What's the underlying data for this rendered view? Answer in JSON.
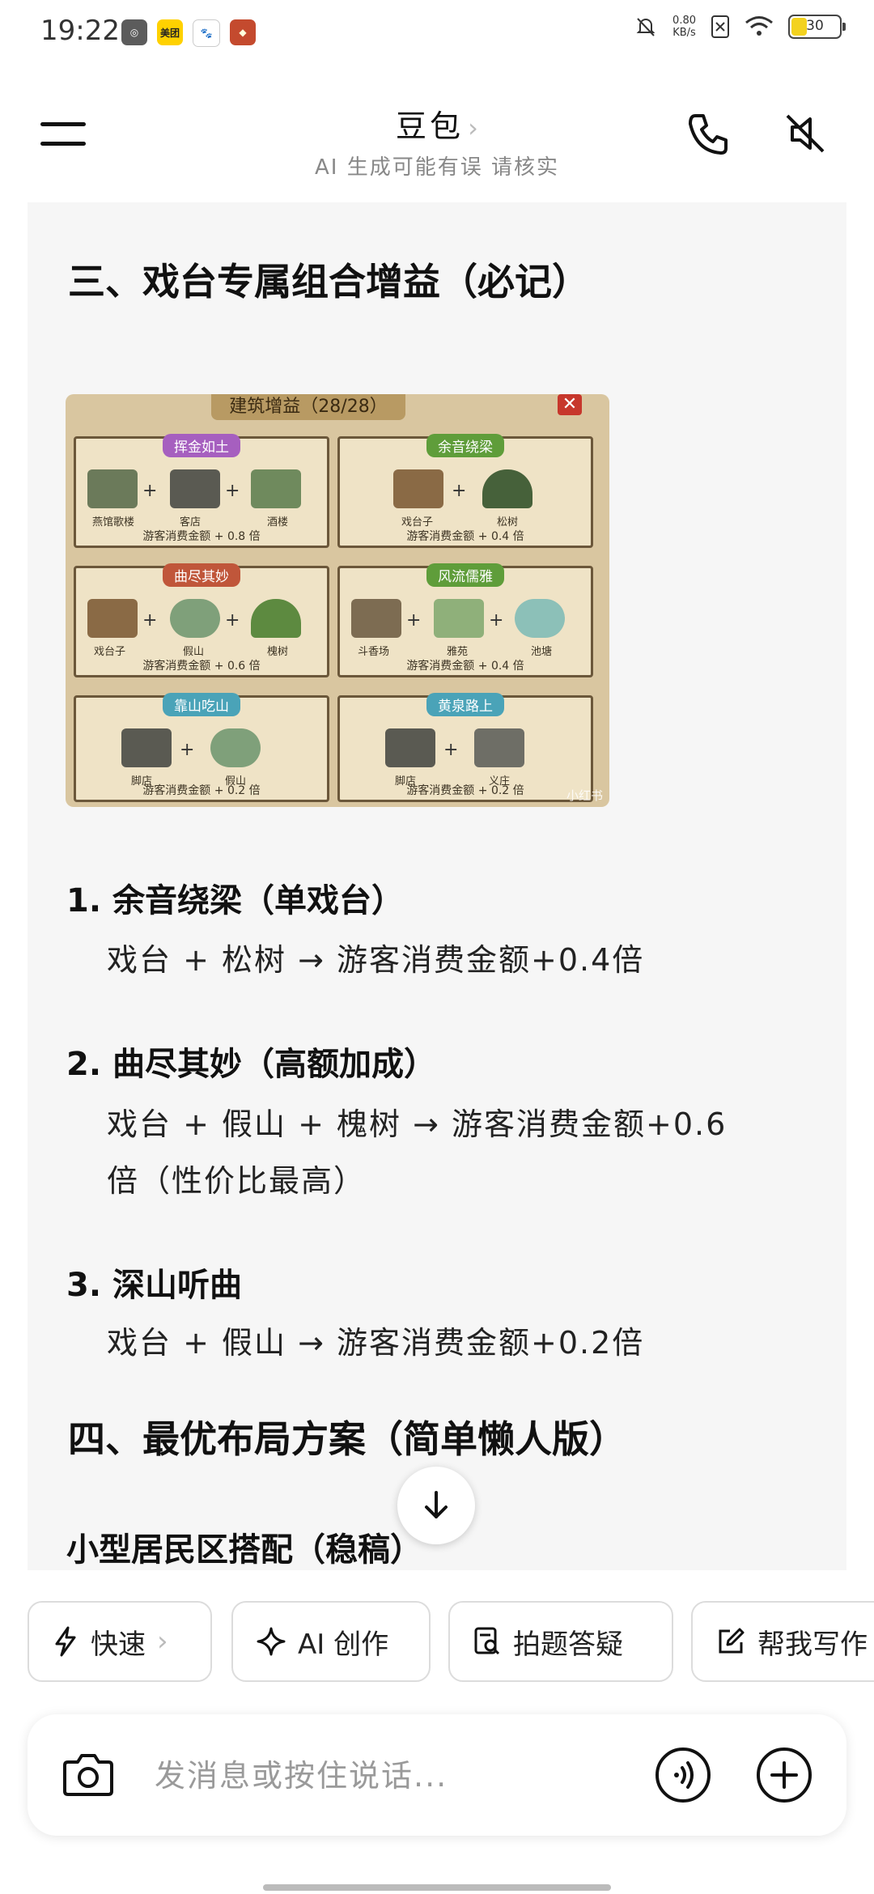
{
  "status_bar": {
    "time": "19:22",
    "app_icons": [
      "weixin-icon",
      "meituan-icon",
      "baidu-icon",
      "game-icon"
    ],
    "meituan_label": "美团",
    "net_speed_value": "0.80",
    "net_speed_unit": "KB/s",
    "battery": "30",
    "battery_level": 0.3
  },
  "header": {
    "title": "豆包",
    "chevron": "›",
    "subtitle": "AI 生成可能有误 请核实"
  },
  "content": {
    "section3_heading": "三、戏台专属组合增益（必记）",
    "image": {
      "header": "建筑增益（28/28）",
      "close": "✕",
      "watermark": "小红书",
      "panels": [
        {
          "tag": "挥金如土",
          "tag_color": "#a65fbf",
          "buildings": [
            "燕馆歌楼",
            "客店",
            "酒楼"
          ],
          "footer": "游客消费金额 + 0.8 倍"
        },
        {
          "tag": "余音绕梁",
          "tag_color": "#5f9d3a",
          "buildings": [
            "戏台子",
            "松树"
          ],
          "footer": "游客消费金额 + 0.4 倍"
        },
        {
          "tag": "曲尽其妙",
          "tag_color": "#c0563a",
          "buildings": [
            "戏台子",
            "假山",
            "槐树"
          ],
          "footer": "游客消费金额 + 0.6 倍"
        },
        {
          "tag": "风流儒雅",
          "tag_color": "#5f9d3a",
          "buildings": [
            "斗香场",
            "雅苑",
            "池塘"
          ],
          "footer": "游客消费金额 + 0.4 倍"
        },
        {
          "tag": "靠山吃山",
          "tag_color": "#4aa3b8",
          "buildings": [
            "脚店",
            "假山"
          ],
          "footer": "游客消费金额 + 0.2 倍"
        },
        {
          "tag": "黄泉路上",
          "tag_color": "#4aa3b8",
          "buildings": [
            "脚店",
            "义庄"
          ],
          "footer": "游客消费金额 + 0.2 倍"
        }
      ]
    },
    "items": [
      {
        "title": "1. 余音绕梁（单戏台）",
        "lines": [
          "戏台 + 松树 → 游客消费金额+0.4倍"
        ]
      },
      {
        "title": "2. 曲尽其妙（高额加成）",
        "lines": [
          "戏台 + 假山 + 槐树 → 游客消费金额+0.6",
          "倍（性价比最高）"
        ]
      },
      {
        "title": "3. 深山听曲",
        "lines": [
          "戏台 + 假山 → 游客消费金额+0.2倍"
        ]
      }
    ],
    "section4_heading": "四、最优布局方案（简单懒人版）",
    "subheading_partial": "小型居民区搭配（稳",
    "subheading_partial_end": "稿）"
  },
  "chips": [
    {
      "label": "快速",
      "icon": "lightning-icon",
      "chevron": "›"
    },
    {
      "label": "AI 创作",
      "icon": "sparkle-icon"
    },
    {
      "label": "拍题答疑",
      "icon": "scan-question-icon"
    },
    {
      "label": "帮我写作",
      "icon": "edit-icon"
    }
  ],
  "input": {
    "placeholder": "发消息或按住说话..."
  }
}
